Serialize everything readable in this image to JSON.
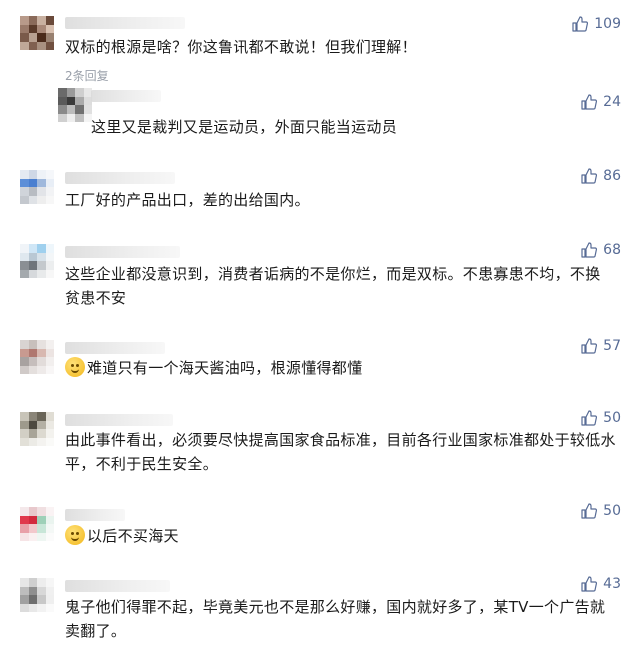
{
  "comments": [
    {
      "text": "双标的根源是啥？你这鲁讯都不敢说！但我们理解！",
      "likes": "109",
      "replies_label": "2条回复"
    },
    {
      "text": "这里又是裁判又是运动员，外面只能当运动员",
      "likes": "24"
    },
    {
      "text": "工厂好的产品出口，差的出给国内。",
      "likes": "86"
    },
    {
      "text": "这些企业都没意识到，消费者诟病的不是你烂，而是双标。不患寡患不均，不换贫患不安",
      "likes": "68"
    },
    {
      "text": "难道只有一个海天酱油吗，根源懂得都懂",
      "likes": "57",
      "emoji": "thinking-emoji"
    },
    {
      "text": "由此事件看出，必须要尽快提高国家食品标准，目前各行业国家标准都处于较低水平，不利于民生安全。",
      "likes": "50"
    },
    {
      "text": "以后不买海天",
      "likes": "50",
      "emoji": "smile-emoji"
    },
    {
      "text": "鬼子他们得罪不起，毕竟美元也不是那么好赚，国内就好多了，某TV一个广告就卖翻了。",
      "likes": "43"
    }
  ],
  "colors": {
    "like": "#576b95",
    "text": "#1a1a1a",
    "meta": "#9aa0aa"
  },
  "icons": {
    "like": "thumb-up-icon"
  }
}
